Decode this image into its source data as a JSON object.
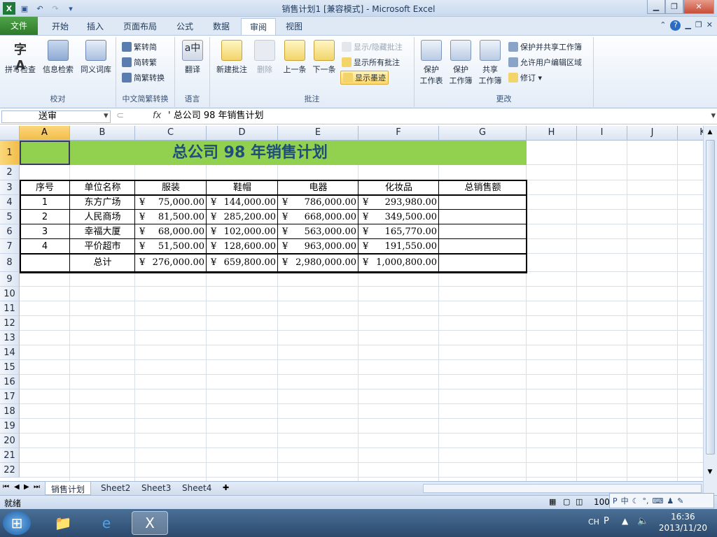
{
  "window": {
    "title": "销售计划1 [兼容模式] - Microsoft Excel",
    "app_icon": "X"
  },
  "qat": {
    "save": "save-icon",
    "undo": "undo-icon",
    "redo": "redo-icon"
  },
  "tabs": {
    "file": "文件",
    "items": [
      "开始",
      "插入",
      "页面布局",
      "公式",
      "数据",
      "审阅",
      "视图"
    ],
    "active": "审阅"
  },
  "ribbon": {
    "proofing": {
      "label": "校对",
      "spell": "拼写检查",
      "research": "信息检索",
      "thesaurus": "同义词库"
    },
    "chinese": {
      "label": "中文简繁转换",
      "to_simp": "繁转简",
      "to_trad": "简转繁",
      "convert": "简繁转换"
    },
    "language": {
      "label": "语言",
      "translate": "翻译"
    },
    "comments": {
      "label": "批注",
      "new": "新建批注",
      "delete": "删除",
      "prev": "上一条",
      "next": "下一条",
      "show_hide": "显示/隐藏批注",
      "show_all": "显示所有批注",
      "show_ink": "显示墨迹"
    },
    "changes": {
      "label": "更改",
      "protect_sheet_1": "保护",
      "protect_sheet_2": "工作表",
      "protect_book_1": "保护",
      "protect_book_2": "工作簿",
      "share_book_1": "共享",
      "share_book_2": "工作簿",
      "protect_share": "保护并共享工作簿",
      "allow_edit": "允许用户编辑区域",
      "track": "修订 ▾"
    }
  },
  "formula_bar": {
    "name_box": "送审",
    "fx": "fx",
    "formula": "' 总公司  98  年销售计划"
  },
  "columns": [
    "A",
    "B",
    "C",
    "D",
    "E",
    "F",
    "G",
    "H",
    "I",
    "J",
    "K"
  ],
  "rows": [
    "1",
    "2",
    "3",
    "4",
    "5",
    "6",
    "7",
    "8",
    "9",
    "10",
    "11",
    "12",
    "13",
    "14",
    "15",
    "16",
    "17",
    "18",
    "19",
    "20",
    "21",
    "22"
  ],
  "sheet": {
    "title": "总公司  98  年销售计划",
    "headers": [
      "序号",
      "单位名称",
      "服装",
      "鞋帽",
      "电器",
      "化妆品",
      "总销售额"
    ],
    "data": [
      [
        "1",
        "东方广场",
        "75,000.00",
        "144,000.00",
        "786,000.00",
        "293,980.00"
      ],
      [
        "2",
        "人民商场",
        "81,500.00",
        "285,200.00",
        "668,000.00",
        "349,500.00"
      ],
      [
        "3",
        "幸福大厦",
        "68,000.00",
        "102,000.00",
        "563,000.00",
        "165,770.00"
      ],
      [
        "4",
        "平价超市",
        "51,500.00",
        "128,600.00",
        "963,000.00",
        "191,550.00"
      ]
    ],
    "total_label": "总计",
    "totals": [
      "276,000.00",
      "659,800.00",
      "2,980,000.00",
      "1,000,800.00"
    ],
    "currency": "¥"
  },
  "sheet_tabs": [
    "销售计划",
    "Sheet2",
    "Sheet3",
    "Sheet4"
  ],
  "status": {
    "ready": "就绪",
    "zoom": "100"
  },
  "taskbar": {
    "lang": "CH",
    "time": "16:36",
    "date": "2013/11/20"
  },
  "colors": {
    "title_fill": "#92d050",
    "title_text": "#1f4e79",
    "selected_header": "#f2bd4a"
  }
}
